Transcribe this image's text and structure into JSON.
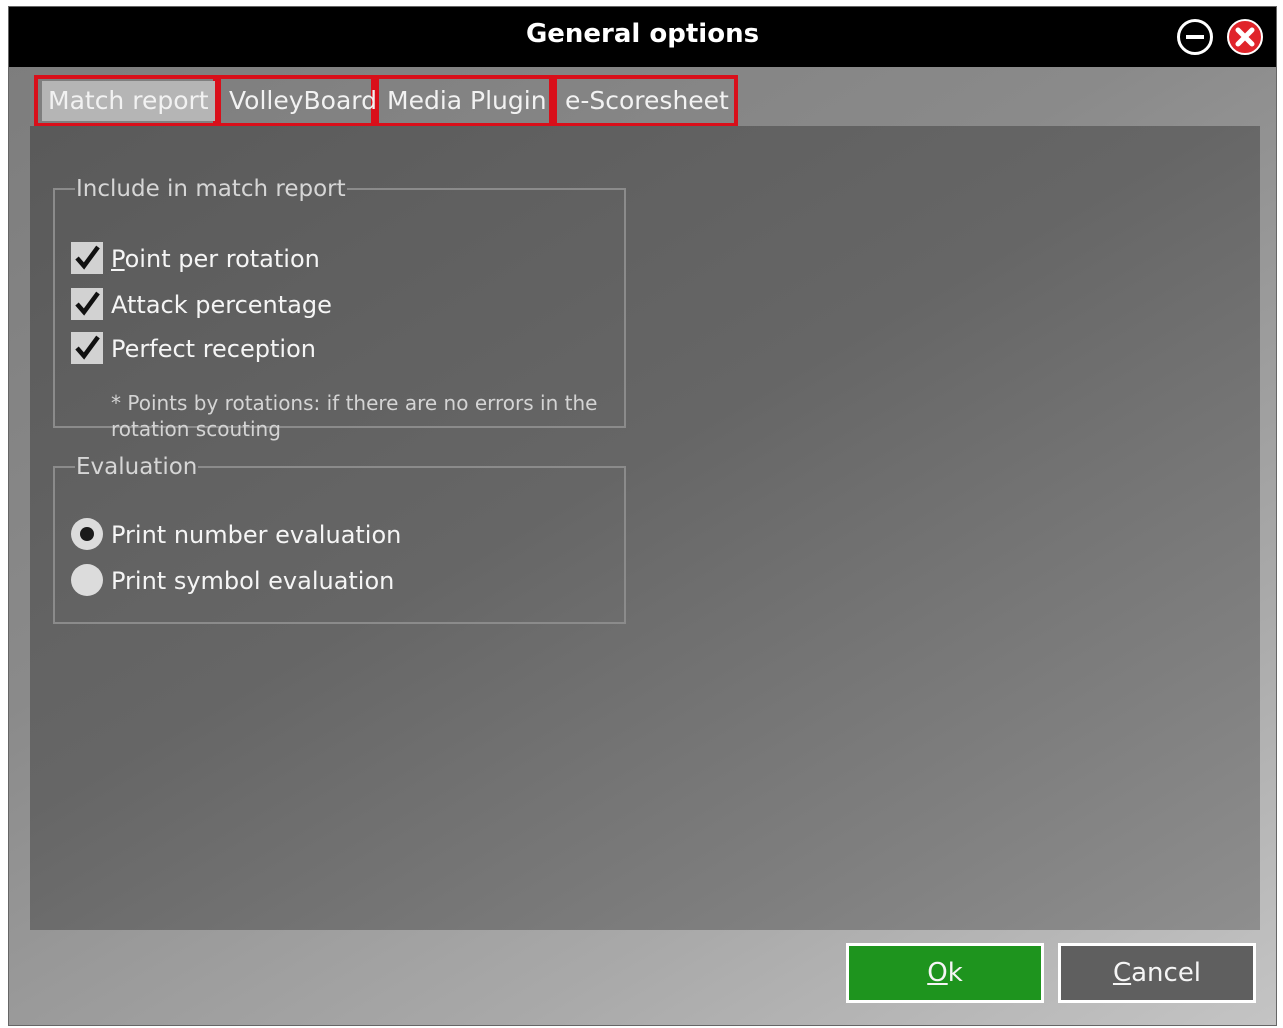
{
  "window": {
    "title": "General options"
  },
  "tabs": [
    {
      "label": "Match report",
      "active": true
    },
    {
      "label": "VolleyBoard",
      "active": false
    },
    {
      "label": "Media Plugin",
      "active": false
    },
    {
      "label": "e-Scoresheet",
      "active": false
    }
  ],
  "include_group": {
    "legend": "Include in match report",
    "options": [
      {
        "label_first": "P",
        "label_rest": "oint per rotation",
        "checked": true
      },
      {
        "label": "Attack percentage",
        "checked": true
      },
      {
        "label": "Perfect reception",
        "checked": true
      }
    ],
    "note": "* Points by rotations: if there are no errors in the rotation scouting"
  },
  "evaluation_group": {
    "legend": "Evaluation",
    "options": [
      {
        "label": "Print number evaluation",
        "selected": true
      },
      {
        "label": "Print symbol evaluation",
        "selected": false
      }
    ]
  },
  "buttons": {
    "ok_first": "O",
    "ok_rest": "k",
    "cancel_first": "C",
    "cancel_rest": "ancel"
  },
  "colors": {
    "tab_highlight": "#d90f1a",
    "ok_button": "#1e941e",
    "close_button": "#e0242a",
    "titlebar": "#000000"
  },
  "icons": [
    "minimize-icon",
    "close-icon",
    "checkmark-icon"
  ]
}
